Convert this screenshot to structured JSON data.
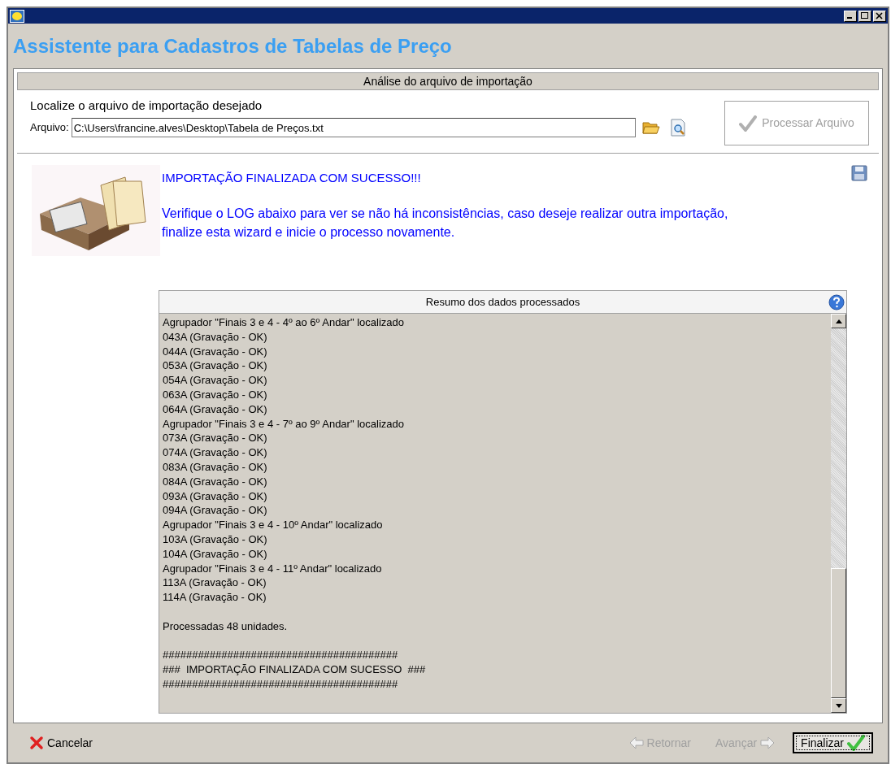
{
  "header": {
    "title": "Assistente para Cadastros de Tabelas de Preço"
  },
  "section": {
    "title": "Análise do arquivo de importação",
    "prompt": "Localize o arquivo de importação desejado",
    "file_label": "Arquivo:",
    "file_value": "C:\\Users\\francine.alves\\Desktop\\Tabela de Preços.txt",
    "process_button": {
      "label": "Processar Arquivo",
      "disabled": true
    }
  },
  "message": {
    "title": "IMPORTAÇÃO FINALIZADA COM SUCESSO!!!",
    "body": "Verifique o LOG abaixo para ver se não há inconsistências, caso deseje realizar outra importação, finalize esta wizard e inicie o processo novamente."
  },
  "log": {
    "title": "Resumo dos dados processados",
    "blocks": [
      [
        "Agrupador \"Finais 3 e 4 - 4º ao 6º Andar\" localizado",
        "043A (Gravação - OK)",
        "044A (Gravação - OK)",
        "053A (Gravação - OK)",
        "054A (Gravação - OK)",
        "063A (Gravação - OK)",
        "064A (Gravação - OK)",
        "Agrupador \"Finais 3 e 4 - 7º ao 9º Andar\" localizado",
        "073A (Gravação - OK)",
        "074A (Gravação - OK)",
        "083A (Gravação - OK)",
        "084A (Gravação - OK)",
        "093A (Gravação - OK)",
        "094A (Gravação - OK)",
        "Agrupador \"Finais 3 e 4 - 10º Andar\" localizado",
        "103A (Gravação - OK)",
        "104A (Gravação - OK)",
        "Agrupador \"Finais 3 e 4 - 11º Andar\" localizado",
        "113A (Gravação - OK)",
        "114A (Gravação - OK)"
      ],
      [
        "Processadas 48 unidades."
      ],
      [
        "########################################",
        "###  IMPORTAÇÃO FINALIZADA COM SUCESSO  ###",
        "########################################"
      ]
    ]
  },
  "footer": {
    "buttons": [
      {
        "kind": "cancel",
        "label": "Cancelar",
        "disabled": false,
        "focused": false
      },
      {
        "kind": "back",
        "label": "Retornar",
        "disabled": true,
        "focused": false
      },
      {
        "kind": "next",
        "label": "Avançar",
        "disabled": true,
        "focused": false
      },
      {
        "kind": "finish",
        "label": "Finalizar",
        "disabled": false,
        "focused": true
      }
    ]
  }
}
